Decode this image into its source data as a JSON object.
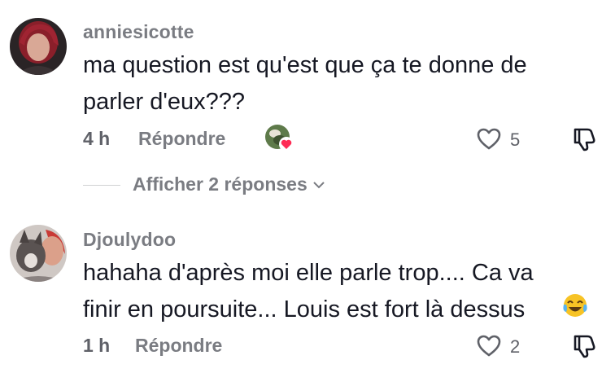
{
  "comments": [
    {
      "username": "anniesicotte",
      "text_line1": "ma question est qu'est que ça te donne de",
      "text_line2": "parler d'eux???",
      "time": "4 h",
      "reply_label": "Répondre",
      "like_count": "5",
      "creator_liked": true,
      "view_replies_label": "Afficher 2 réponses"
    },
    {
      "username": "Djoulydoo",
      "text_line1": "hahaha d'après moi elle parle trop.... Ca va",
      "text_line2": "finir en poursuite... Louis est fort là dessus",
      "emoji": "face-with-tears-of-joy",
      "time": "1 h",
      "reply_label": "Répondre",
      "like_count": "2"
    }
  ],
  "colors": {
    "text": "#161823",
    "muted": "#7a7c82",
    "heart_badge": "#fe2c55"
  }
}
